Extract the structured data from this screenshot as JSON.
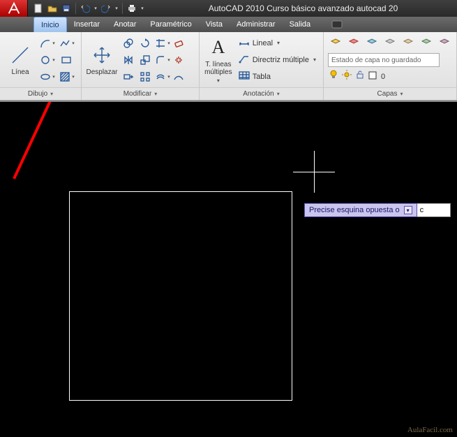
{
  "app": {
    "title": "AutoCAD 2010   Curso básico avanzado autocad 20"
  },
  "tabs": {
    "items": [
      {
        "label": "Inicio"
      },
      {
        "label": "Insertar"
      },
      {
        "label": "Anotar"
      },
      {
        "label": "Paramétrico"
      },
      {
        "label": "Vista"
      },
      {
        "label": "Administrar"
      },
      {
        "label": "Salida"
      }
    ]
  },
  "panels": {
    "dibujo": {
      "title": "Dibujo",
      "linea": "Línea"
    },
    "modificar": {
      "title": "Modificar",
      "desplazar": "Desplazar"
    },
    "anotacion": {
      "title": "Anotación",
      "texto": "T. líneas múltiples",
      "lineal": "Lineal",
      "directriz": "Directriz múltiple",
      "tabla": "Tabla"
    },
    "capas": {
      "title": "Capas",
      "placeholder": "Estado de capa no guardado",
      "current": "0"
    }
  },
  "prompt": {
    "label": "Precise esquina opuesta o",
    "value": "c"
  },
  "watermark": "AulaFacil.com"
}
